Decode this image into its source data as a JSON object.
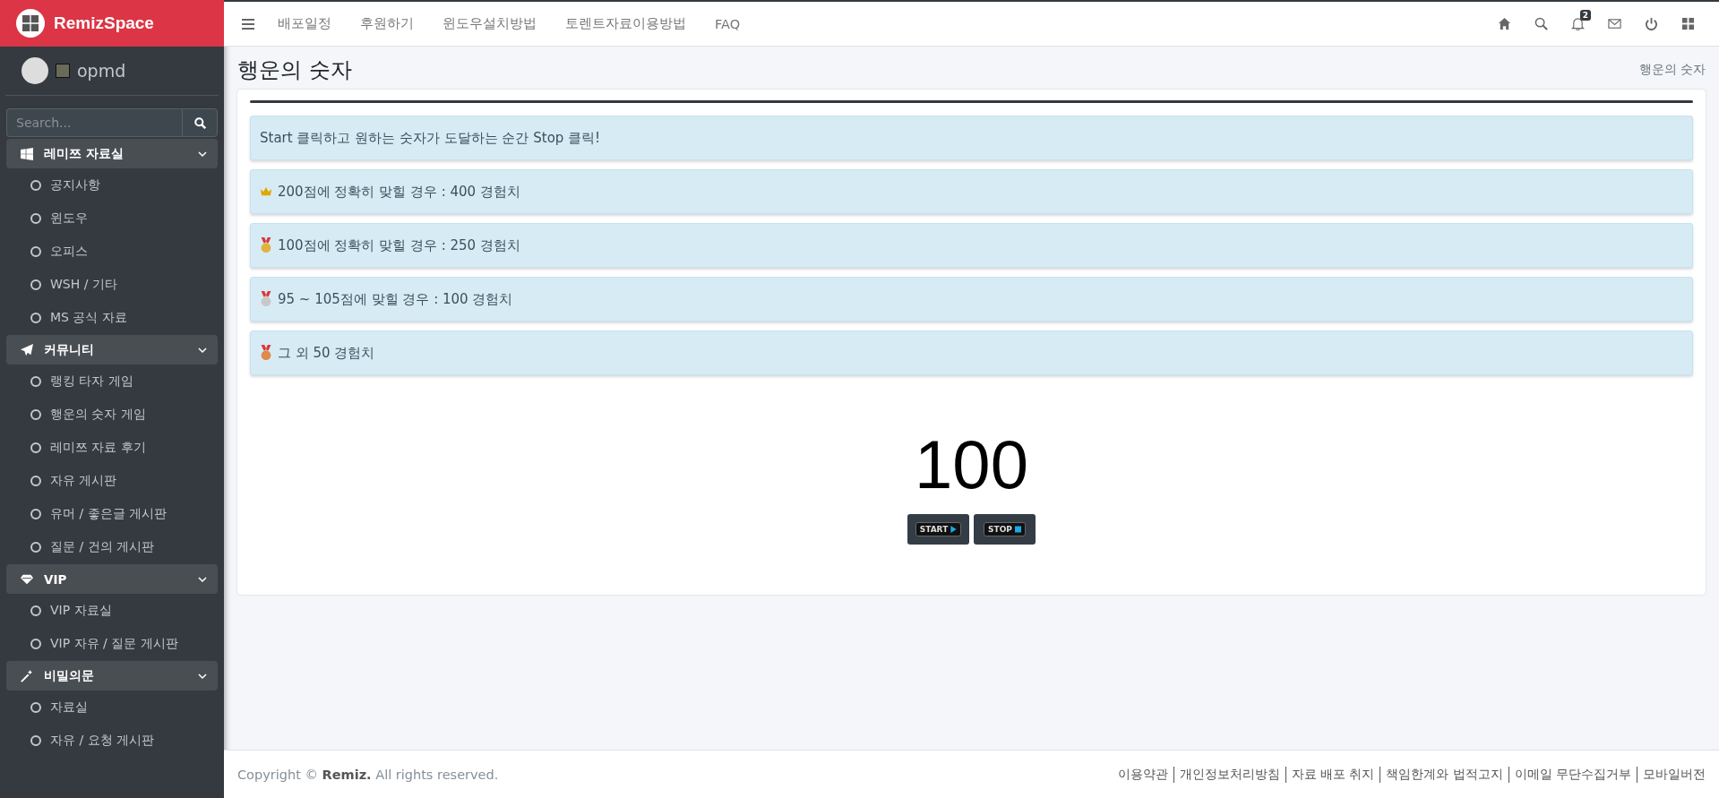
{
  "brand": {
    "name": "RemizSpace"
  },
  "user": {
    "name": "opmd"
  },
  "sidebar_search": {
    "placeholder": "Search..."
  },
  "sidebar": {
    "groups": [
      {
        "label": "레미쯔 자료실",
        "kind": "windows",
        "expanded": true,
        "items": [
          "공지사항",
          "윈도우",
          "오피스",
          "WSH / 기타",
          "MS 공식 자료"
        ]
      },
      {
        "label": "커뮤니티",
        "kind": "plane",
        "expanded": true,
        "items": [
          "랭킹 타자 게임",
          "행운의 숫자 게임",
          "레미쯔 자료 후기",
          "자유 게시판",
          "유머 / 좋은글 게시판",
          "질문 / 건의 게시판"
        ]
      },
      {
        "label": "VIP",
        "kind": "diamond",
        "expanded": true,
        "items": [
          "VIP 자료실",
          "VIP 자유 / 질문 게시판"
        ]
      },
      {
        "label": "비밀의문",
        "kind": "wand",
        "expanded": true,
        "items": [
          "자료실",
          "자유 / 요청 게시판"
        ]
      }
    ]
  },
  "topnav": {
    "links": [
      "배포일정",
      "후원하기",
      "윈도우설치방법",
      "토렌트자료이용방법",
      "FAQ"
    ],
    "icons": [
      {
        "kind": "home"
      },
      {
        "kind": "search"
      },
      {
        "kind": "bell",
        "badge": "2"
      },
      {
        "kind": "mail"
      },
      {
        "kind": "power"
      },
      {
        "kind": "grid"
      }
    ]
  },
  "page": {
    "title": "행운의 숫자",
    "breadcrumb": "행운의 숫자"
  },
  "alerts": [
    {
      "kind": "text",
      "text": "Start 클릭하고 원하는 숫자가 도달하는 순간 Stop 클릭!"
    },
    {
      "kind": "crown",
      "text": "200점에 정확히 맞힐 경우 : 400 경험치"
    },
    {
      "kind": "gold",
      "text": "100점에 정확히 맞힐 경우 : 250 경험치"
    },
    {
      "kind": "silver",
      "text": "95 ~ 105점에 맞힐 경우 : 100 경험치"
    },
    {
      "kind": "bronze",
      "text": "그 외 50 경험치"
    }
  ],
  "game": {
    "number": "100",
    "buttons": [
      {
        "kind": "start",
        "label": "START"
      },
      {
        "kind": "stop",
        "label": "STOP"
      }
    ]
  },
  "footer": {
    "copyright": "Copyright © **Remiz.** All rights reserved.",
    "links": [
      "이용약관",
      "개인정보처리방침",
      "자료 배포 취지",
      "책임한계와 법적고지",
      "이메일 무단수집거부",
      "모바일버전"
    ]
  }
}
